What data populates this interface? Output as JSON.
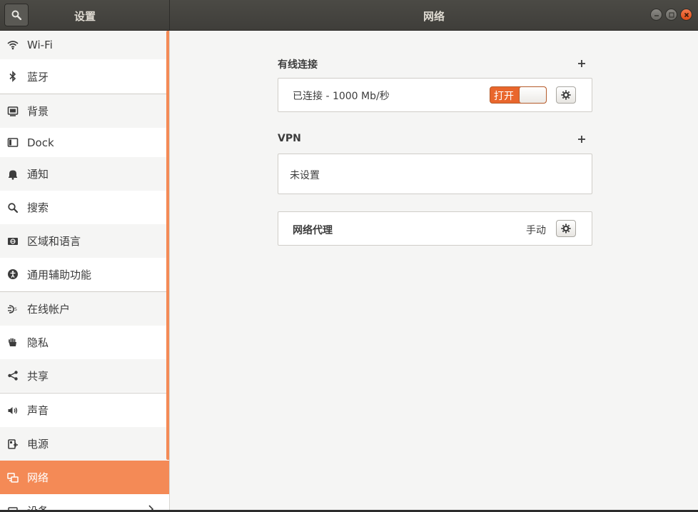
{
  "app": {
    "sidebar_title": "设置",
    "page_title": "网络"
  },
  "sidebar": {
    "items": [
      {
        "label": "Wi-Fi",
        "icon": "wifi-icon"
      },
      {
        "label": "蓝牙",
        "icon": "bluetooth-icon"
      },
      {
        "label": "背景",
        "icon": "background-icon"
      },
      {
        "label": "Dock",
        "icon": "dock-icon"
      },
      {
        "label": "通知",
        "icon": "bell-icon"
      },
      {
        "label": "搜索",
        "icon": "search-icon"
      },
      {
        "label": "区域和语言",
        "icon": "region-icon"
      },
      {
        "label": "通用辅助功能",
        "icon": "accessibility-icon"
      },
      {
        "label": "在线帐户",
        "icon": "online-accounts-icon"
      },
      {
        "label": "隐私",
        "icon": "privacy-hand-icon"
      },
      {
        "label": "共享",
        "icon": "share-icon"
      },
      {
        "label": "声音",
        "icon": "speaker-icon"
      },
      {
        "label": "电源",
        "icon": "power-icon"
      },
      {
        "label": "网络",
        "icon": "network-icon"
      },
      {
        "label": "设备",
        "icon": "devices-icon"
      }
    ],
    "active_index": 13
  },
  "wired": {
    "title": "有线连接",
    "status": "已连接 - 1000 Mb/秒",
    "toggle_label": "打开"
  },
  "vpn": {
    "title": "VPN",
    "status": "未设置"
  },
  "proxy": {
    "title": "网络代理",
    "value": "手动"
  },
  "colors": {
    "accent": "#f48a56",
    "toggle_on": "#e9662c",
    "header": "#45443f"
  }
}
